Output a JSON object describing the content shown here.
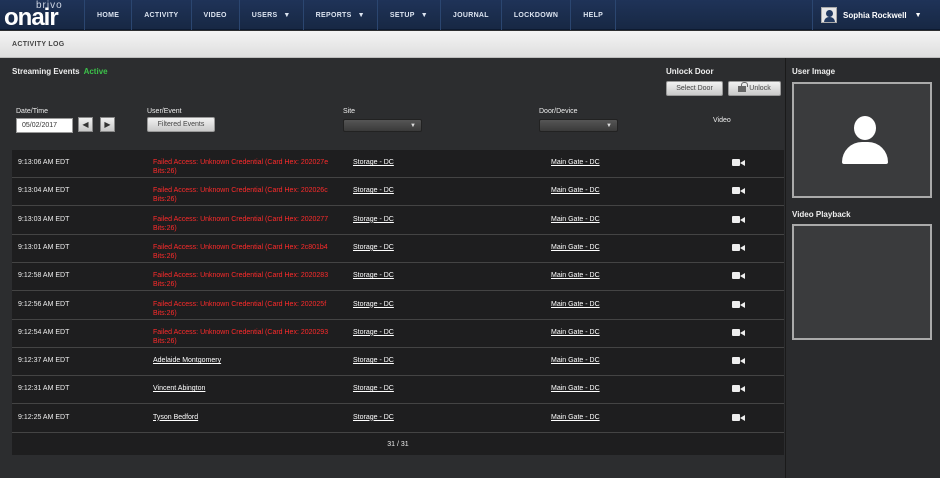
{
  "logo": {
    "top": "brivo",
    "main": "onair"
  },
  "nav": [
    {
      "label": "HOME",
      "dropdown": false
    },
    {
      "label": "ACTIVITY",
      "dropdown": false
    },
    {
      "label": "VIDEO",
      "dropdown": false
    },
    {
      "label": "USERS",
      "dropdown": true
    },
    {
      "label": "REPORTS",
      "dropdown": true
    },
    {
      "label": "SETUP",
      "dropdown": true
    },
    {
      "label": "JOURNAL",
      "dropdown": false
    },
    {
      "label": "LOCKDOWN",
      "dropdown": false
    },
    {
      "label": "HELP",
      "dropdown": false
    }
  ],
  "user": {
    "name": "Sophia Rockwell"
  },
  "page": {
    "title": "ACTIVITY LOG"
  },
  "stream": {
    "label": "Streaming Events",
    "status": "Active",
    "status_color": "#3cc24a"
  },
  "unlock": {
    "title": "Unlock Door",
    "select_label": "Select Door",
    "unlock_label": "Unlock"
  },
  "filters": {
    "date_label": "Date/Time",
    "date_value": "05/02/2017",
    "user_label": "User/Event",
    "filter_button": "Filtered Events",
    "site_label": "Site",
    "door_label": "Door/Device",
    "video_label": "Video"
  },
  "rows": [
    {
      "time": "9:13:06 AM EDT",
      "event": "Failed Access: Unknown Credential (Card Hex: 202027e Bits:26)",
      "failed": true,
      "site": "Storage - DC",
      "door": "Main Gate - DC"
    },
    {
      "time": "9:13:04 AM EDT",
      "event": "Failed Access: Unknown Credential (Card Hex: 202026c Bits:26)",
      "failed": true,
      "site": "Storage - DC",
      "door": "Main Gate - DC"
    },
    {
      "time": "9:13:03 AM EDT",
      "event": "Failed Access: Unknown Credential (Card Hex: 2020277 Bits:26)",
      "failed": true,
      "site": "Storage - DC",
      "door": "Main Gate - DC"
    },
    {
      "time": "9:13:01 AM EDT",
      "event": "Failed Access: Unknown Credential (Card Hex: 2c801b4 Bits:26)",
      "failed": true,
      "site": "Storage - DC",
      "door": "Main Gate - DC"
    },
    {
      "time": "9:12:58 AM EDT",
      "event": "Failed Access: Unknown Credential (Card Hex: 2020283 Bits:26)",
      "failed": true,
      "site": "Storage - DC",
      "door": "Main Gate - DC"
    },
    {
      "time": "9:12:56 AM EDT",
      "event": "Failed Access: Unknown Credential (Card Hex: 202025f Bits:26)",
      "failed": true,
      "site": "Storage - DC",
      "door": "Main Gate - DC"
    },
    {
      "time": "9:12:54 AM EDT",
      "event": "Failed Access: Unknown Credential (Card Hex: 2020293 Bits:26)",
      "failed": true,
      "site": "Storage - DC",
      "door": "Main Gate - DC"
    },
    {
      "time": "9:12:37 AM EDT",
      "event": "Adelaide Montgomery",
      "failed": false,
      "site": "Storage - DC",
      "door": "Main Gate - DC"
    },
    {
      "time": "9:12:31 AM EDT",
      "event": "Vincent Abington",
      "failed": false,
      "site": "Storage - DC",
      "door": "Main Gate - DC"
    },
    {
      "time": "9:12:25 AM EDT",
      "event": "Tyson Bedford",
      "failed": false,
      "site": "Storage - DC",
      "door": "Main Gate - DC"
    }
  ],
  "pagination": {
    "text": "31 / 31"
  },
  "side": {
    "user_image_label": "User Image",
    "video_playback_label": "Video Playback"
  },
  "colors": {
    "nav_bg": "#1f3358",
    "failed_text": "#ff2b2b"
  }
}
